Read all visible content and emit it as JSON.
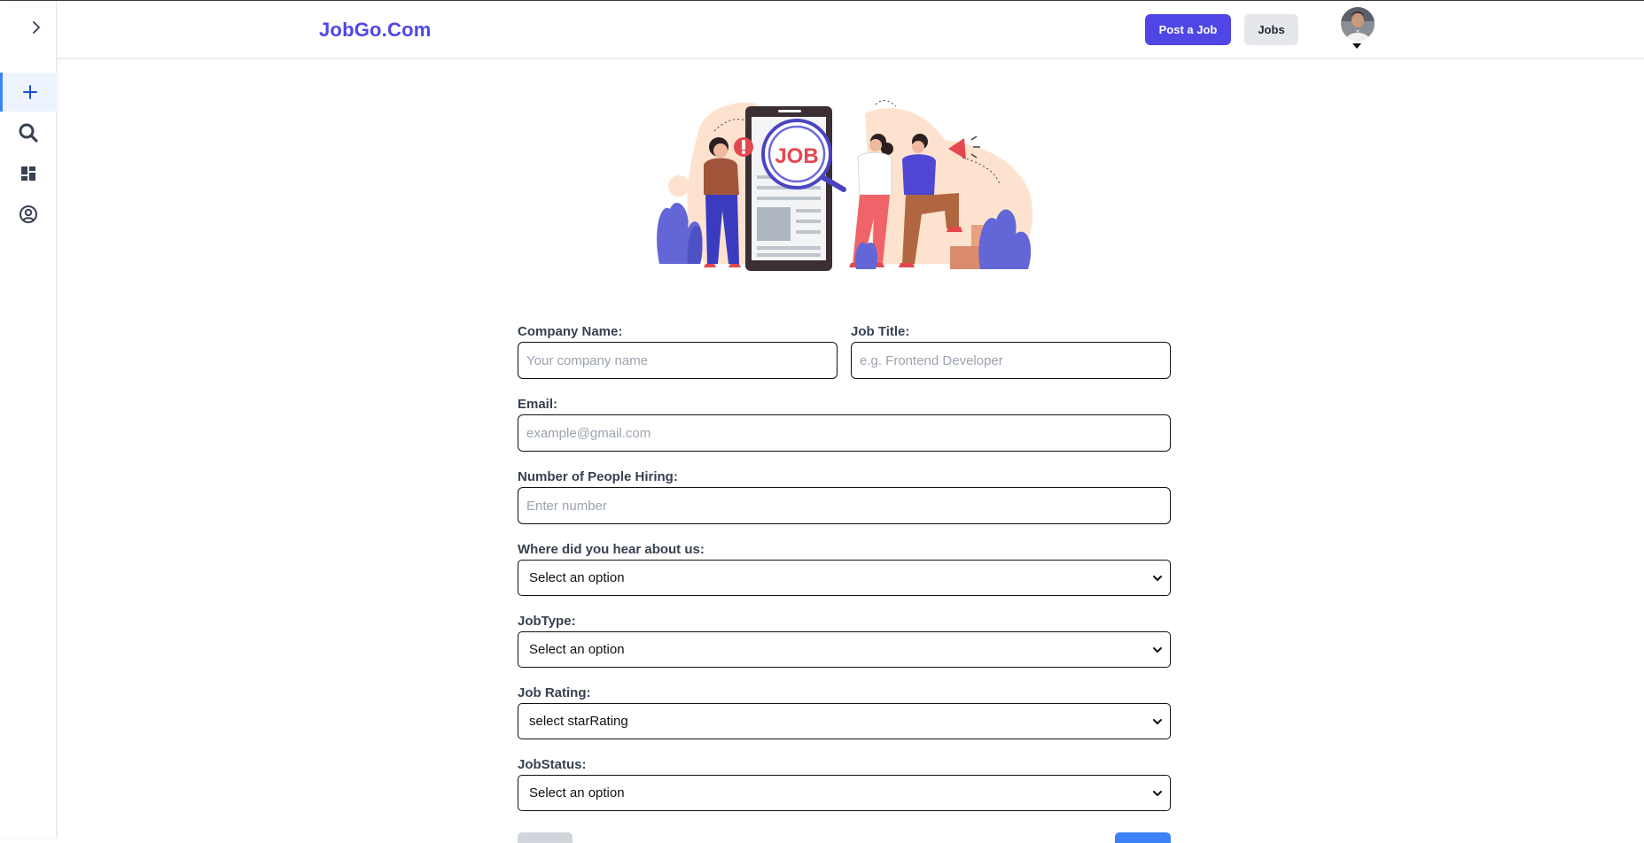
{
  "header": {
    "brand": "JobGo.Com",
    "post_job_label": "Post a Job",
    "jobs_label": "Jobs"
  },
  "sidebar": {
    "items": [
      {
        "icon": "plus-icon",
        "active": true
      },
      {
        "icon": "search-icon",
        "active": false
      },
      {
        "icon": "dashboard-icon",
        "active": false
      },
      {
        "icon": "user-circle-icon",
        "active": false
      }
    ]
  },
  "form": {
    "company_name": {
      "label": "Company Name:",
      "placeholder": "Your company name",
      "value": ""
    },
    "job_title": {
      "label": "Job Title:",
      "placeholder": "e.g. Frontend Developer",
      "value": ""
    },
    "email": {
      "label": "Email:",
      "placeholder": "example@gmail.com",
      "value": ""
    },
    "people_hiring": {
      "label": "Number of People Hiring:",
      "placeholder": "Enter number",
      "value": ""
    },
    "hear_about": {
      "label": "Where did you hear about us:",
      "selected": "Select an option"
    },
    "job_type": {
      "label": "JobType:",
      "selected": "Select an option"
    },
    "job_rating": {
      "label": "Job Rating:",
      "selected": "select starRating"
    },
    "job_status": {
      "label": "JobStatus:",
      "selected": "Select an option"
    }
  },
  "colors": {
    "brand": "#4f46e5",
    "accent_blue": "#3b82f6",
    "secondary_button": "#e5e7eb",
    "label_text": "#374151"
  }
}
